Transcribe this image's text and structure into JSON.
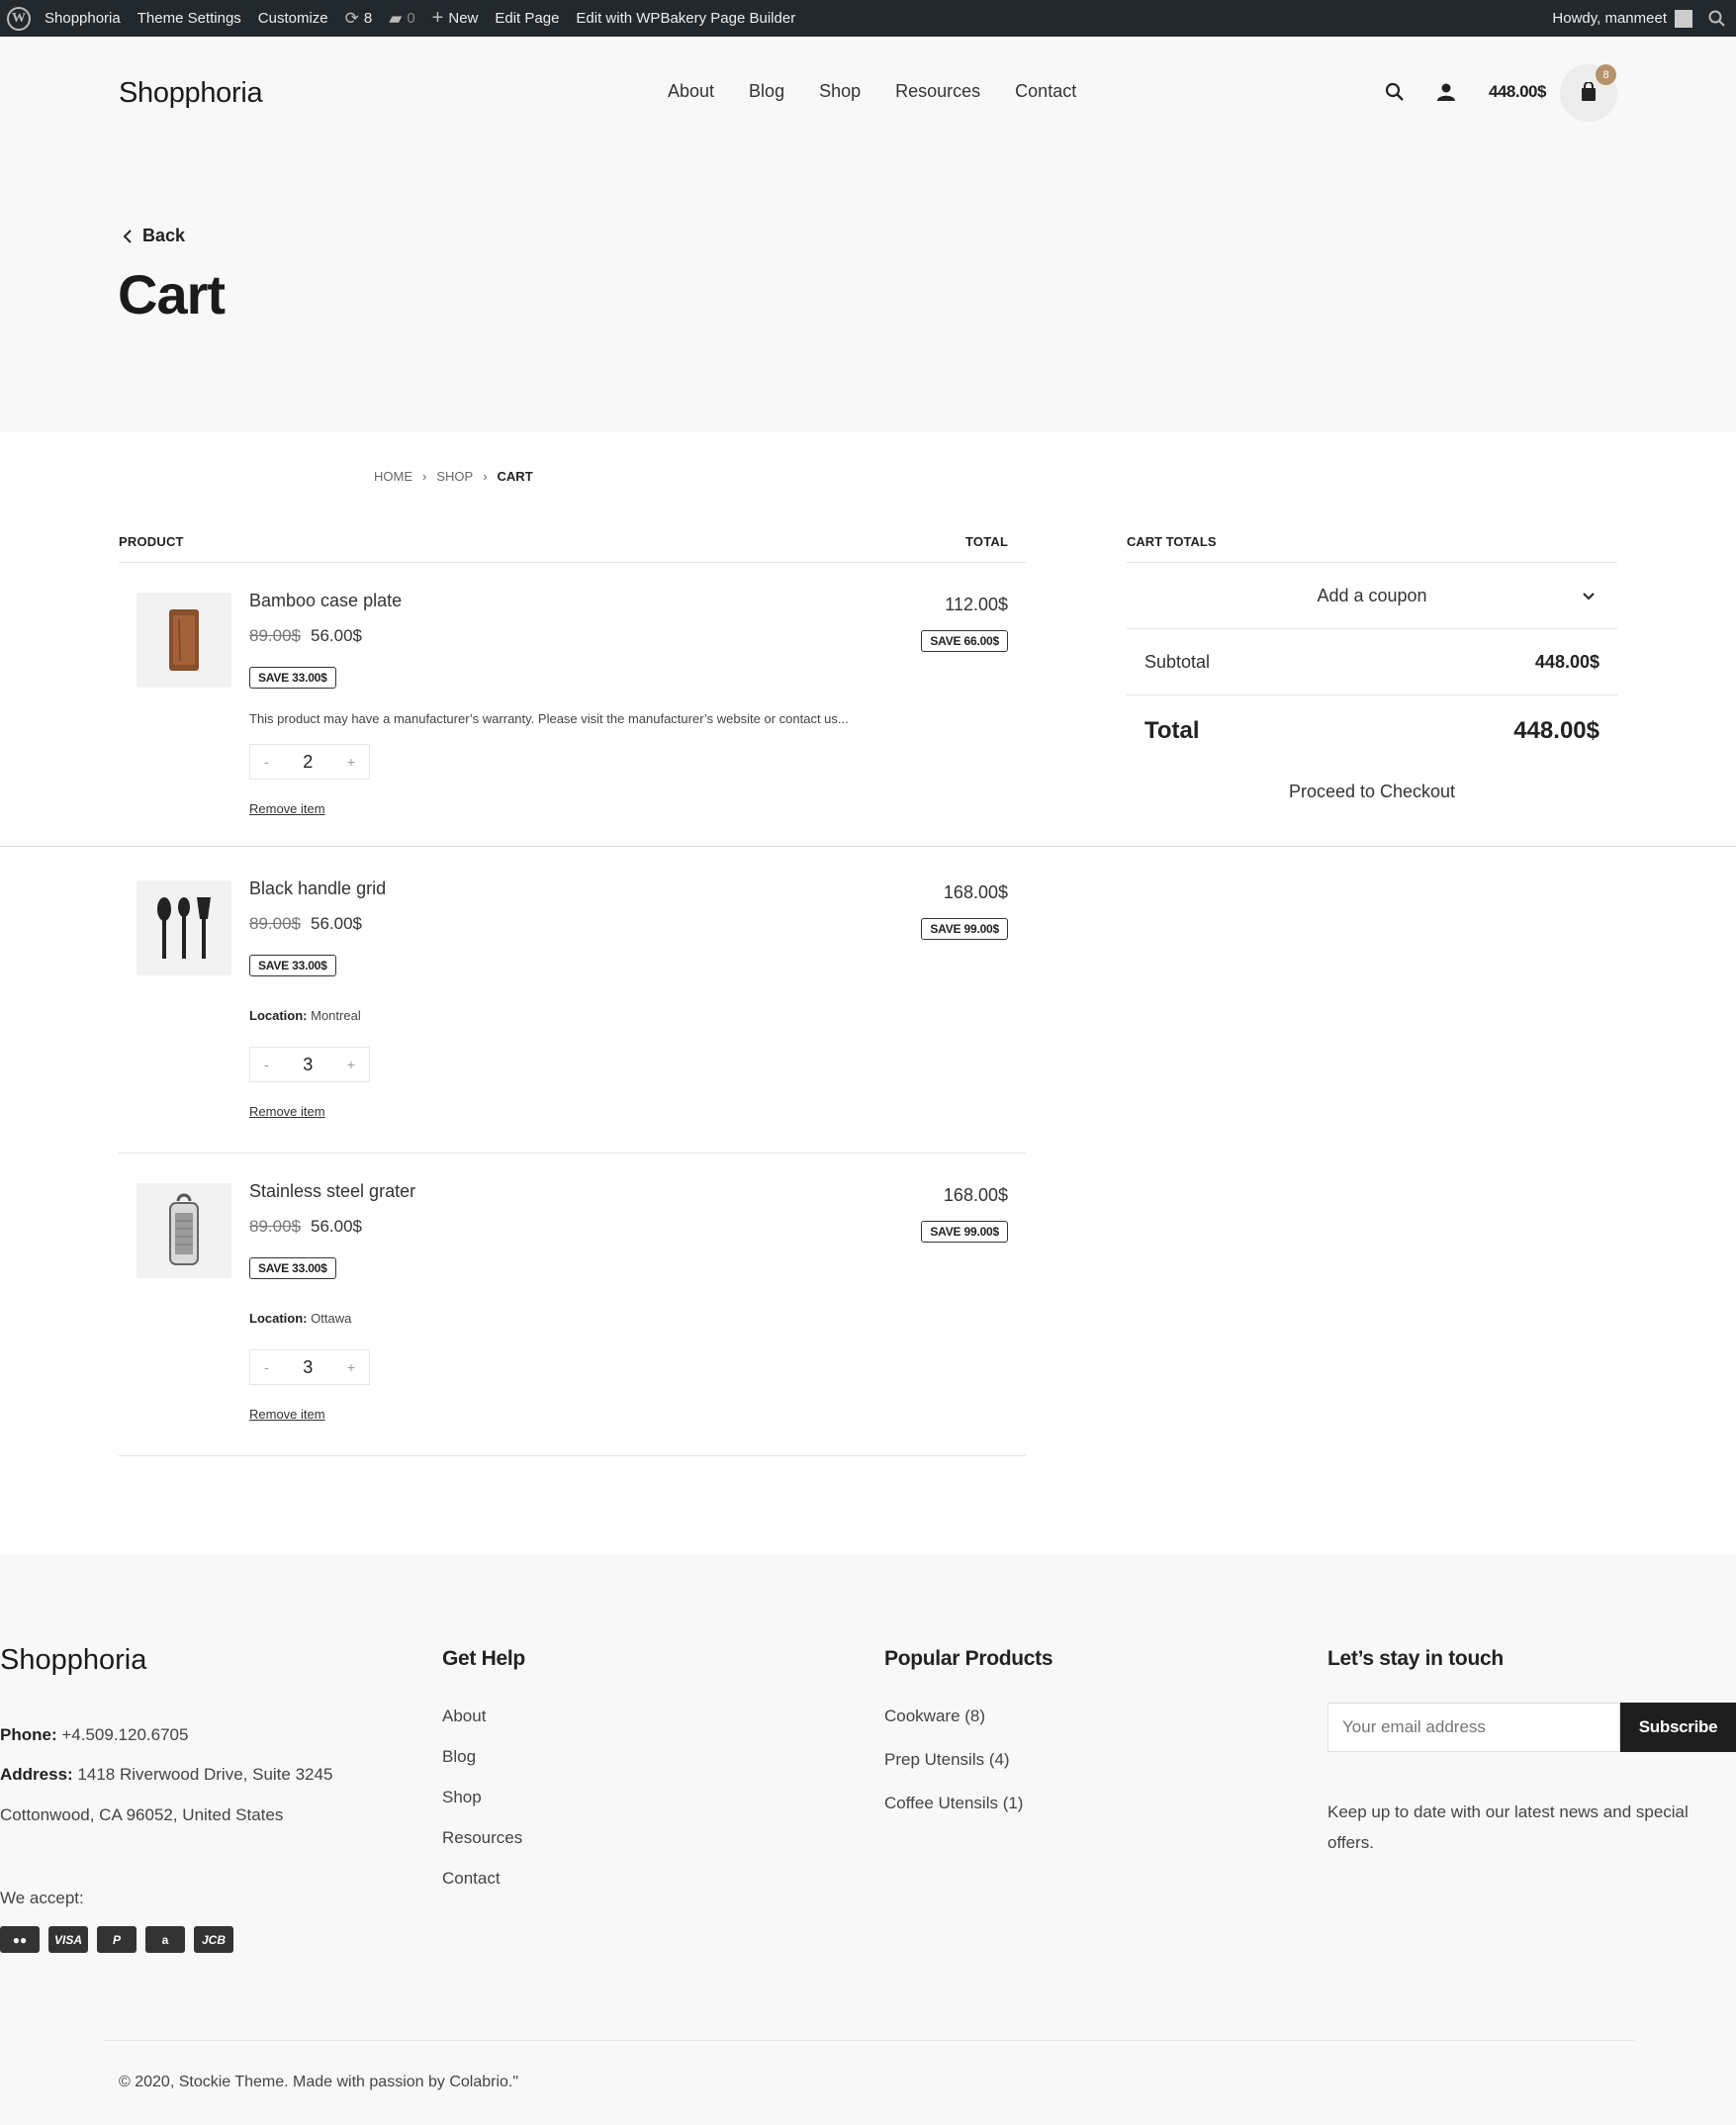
{
  "admin_bar": {
    "site": "Shopphoria",
    "theme_settings": "Theme Settings",
    "customize": "Customize",
    "updates": "8",
    "comments": "0",
    "new": "New",
    "edit_page": "Edit Page",
    "wpbakery": "Edit with WPBakery Page Builder",
    "howdy": "Howdy, manmeet"
  },
  "header": {
    "logo": "Shopphoria",
    "nav": [
      "About",
      "Blog",
      "Shop",
      "Resources",
      "Contact"
    ],
    "cart_total": "448.00$",
    "cart_count": "8"
  },
  "page": {
    "back": "Back",
    "title": "Cart"
  },
  "breadcrumb": [
    "HOME",
    "SHOP",
    "CART"
  ],
  "cart": {
    "col_product": "PRODUCT",
    "col_total": "TOTAL",
    "items": [
      {
        "name": "Bamboo case plate",
        "old_price": "89.00$",
        "price": "56.00$",
        "save_unit": "SAVE 33.00$",
        "line_total": "112.00$",
        "save_total": "SAVE 66.00$",
        "note": "This product may have a manufacturer’s warranty. Please visit the manufacturer’s website or contact us...",
        "qty": "2",
        "remove": "Remove item"
      },
      {
        "name": "Black handle grid",
        "old_price": "89.00$",
        "price": "56.00$",
        "save_unit": "SAVE 33.00$",
        "line_total": "168.00$",
        "save_total": "SAVE 99.00$",
        "location_label": "Location:",
        "location": "Montreal",
        "qty": "3",
        "remove": "Remove item"
      },
      {
        "name": "Stainless steel grater",
        "old_price": "89.00$",
        "price": "56.00$",
        "save_unit": "SAVE 33.00$",
        "line_total": "168.00$",
        "save_total": "SAVE 99.00$",
        "location_label": "Location:",
        "location": "Ottawa",
        "qty": "3",
        "remove": "Remove item"
      }
    ]
  },
  "totals": {
    "heading": "CART TOTALS",
    "coupon": "Add a coupon",
    "subtotal_label": "Subtotal",
    "subtotal": "448.00$",
    "total_label": "Total",
    "total": "448.00$",
    "checkout": "Proceed to Checkout"
  },
  "footer": {
    "logo": "Shopphoria",
    "phone_label": "Phone:",
    "phone": "+4.509.120.6705",
    "address_label": "Address:",
    "address1": "1418 Riverwood Drive, Suite 3245",
    "address2": "Cottonwood, CA 96052, United States",
    "we_accept": "We accept:",
    "payment_icons": [
      "mastercard-icon",
      "visa-icon",
      "paypal-icon",
      "amazon-icon",
      "jcb-icon"
    ],
    "get_help_title": "Get Help",
    "get_help": [
      "About",
      "Blog",
      "Shop",
      "Resources",
      "Contact"
    ],
    "popular_title": "Popular Products",
    "popular": [
      "Cookware (8)",
      "Prep Utensils (4)",
      "Coffee Utensils (1)"
    ],
    "touch_title": "Let’s stay in touch",
    "email_placeholder": "Your email address",
    "subscribe": "Subscribe",
    "blurb": "Keep up to date with our latest news and special offers.",
    "copyright": "© 2020, Stockie Theme. Made with passion by Colabrio.\""
  },
  "colors": {
    "admin_bar": "#23282d",
    "badge": "#b6926a",
    "header_bg": "#f8f8f8",
    "button_dark": "#1e1e1e"
  }
}
